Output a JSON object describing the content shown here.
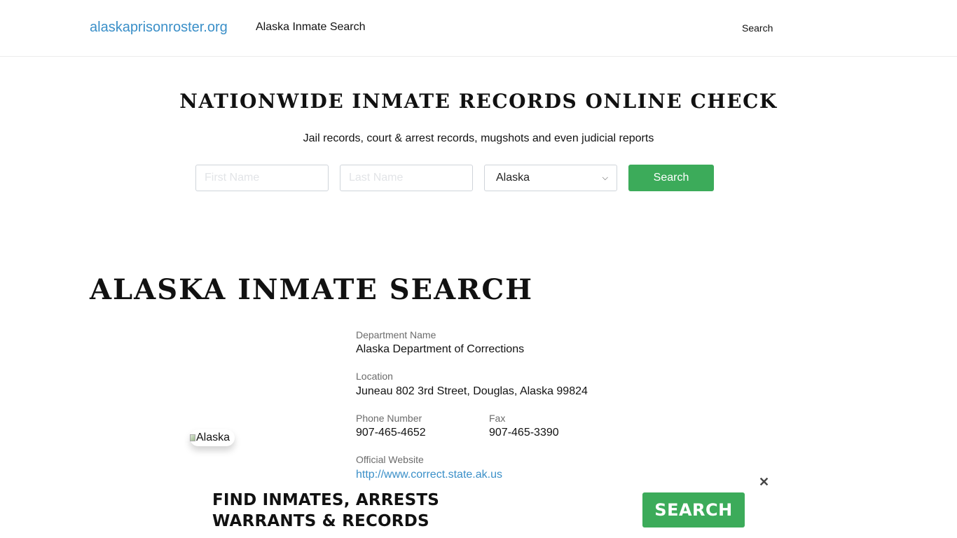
{
  "header": {
    "brand": "alaskaprisonroster.org",
    "nav_link": "Alaska Inmate Search",
    "nav_search": "Search"
  },
  "hero": {
    "title": "NATIONWIDE INMATE RECORDS ONLINE CHECK",
    "subtitle": "Jail records, court & arrest records, mugshots and even judicial reports",
    "first_name_placeholder": "First Name",
    "last_name_placeholder": "Last Name",
    "state_selected": "Alaska",
    "search_label": "Search"
  },
  "main": {
    "title": "ALASKA INMATE SEARCH",
    "image_alt": "Alaska",
    "department_label": "Department Name",
    "department_value": "Alaska Department of Corrections",
    "location_label": "Location",
    "location_value": "Juneau 802 3rd Street, Douglas, Alaska 99824",
    "phone_label": "Phone Number",
    "phone_value": "907-465-4652",
    "fax_label": "Fax",
    "fax_value": "907-465-3390",
    "website_label": "Official Website",
    "website_value": "http://www.correct.state.ak.us"
  },
  "ad": {
    "line1": "FIND INMATES, ARRESTS",
    "line2": "WARRANTS & RECORDS",
    "button": "SEARCH",
    "close": "✕"
  },
  "colors": {
    "brand_link": "#3a8fc8",
    "button_green": "#3cab5a"
  }
}
